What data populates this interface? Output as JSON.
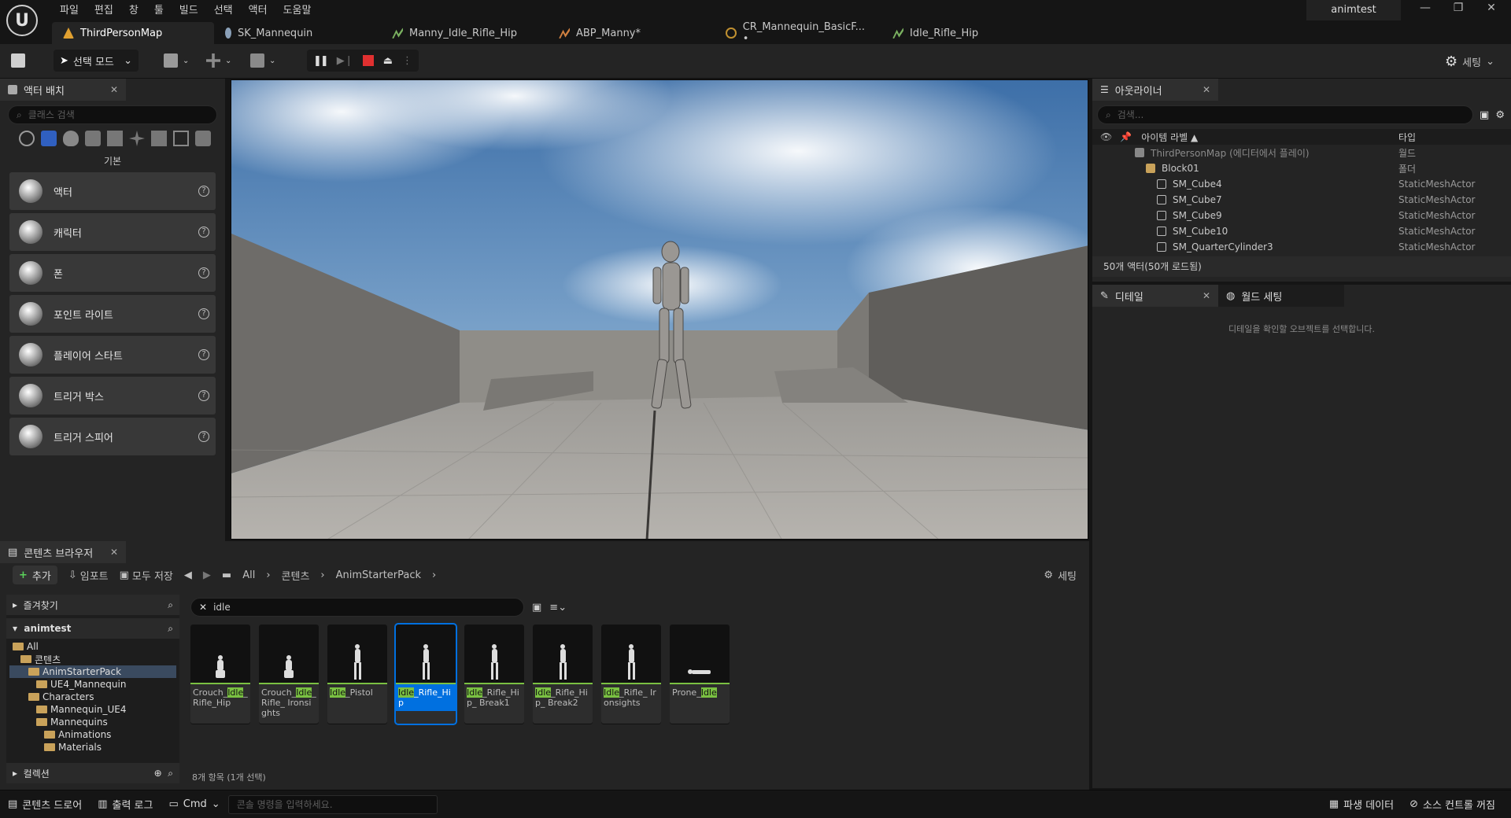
{
  "app": {
    "logo": "U",
    "project": "animtest"
  },
  "menu": [
    "파일",
    "편집",
    "창",
    "툴",
    "빌드",
    "선택",
    "액터",
    "도움말"
  ],
  "window_controls": [
    "—",
    "❐",
    "✕"
  ],
  "tabs": [
    {
      "label": "ThirdPersonMap",
      "icon": "map-icon",
      "color": "#e0a030",
      "active": true
    },
    {
      "label": "SK_Mannequin",
      "icon": "skeleton-icon",
      "color": "#9ab",
      "active": false
    },
    {
      "label": "Manny_Idle_Rifle_Hip",
      "icon": "anim-sequence-icon",
      "color": "#8c6",
      "active": false
    },
    {
      "label": "ABP_Manny*",
      "icon": "anim-blueprint-icon",
      "color": "#d84",
      "active": false
    },
    {
      "label": "CR_Mannequin_BasicF... •",
      "icon": "control-rig-icon",
      "color": "#c93",
      "active": false
    },
    {
      "label": "Idle_Rifle_Hip",
      "icon": "anim-sequence-icon",
      "color": "#8c6",
      "active": false
    }
  ],
  "toolbar": {
    "select_mode": "선택 모드",
    "settings": "세팅"
  },
  "place_actors": {
    "title": "액터 배치",
    "search_placeholder": "클래스 검색",
    "category": "기본",
    "items": [
      "액터",
      "캐릭터",
      "폰",
      "포인트 라이트",
      "플레이어 스타트",
      "트리거 박스",
      "트리거 스피어"
    ]
  },
  "outliner": {
    "title": "아웃라이너",
    "search_placeholder": "검색...",
    "col_label": "아이템 라벨 ▲",
    "col_type": "타입",
    "rows": [
      {
        "label": "ThirdPersonMap (에디터에서 플레이)",
        "type": "월드",
        "indent": 0
      },
      {
        "label": "Block01",
        "type": "폴더",
        "indent": 1
      },
      {
        "label": "SM_Cube4",
        "type": "StaticMeshActor",
        "indent": 2
      },
      {
        "label": "SM_Cube7",
        "type": "StaticMeshActor",
        "indent": 2
      },
      {
        "label": "SM_Cube9",
        "type": "StaticMeshActor",
        "indent": 2
      },
      {
        "label": "SM_Cube10",
        "type": "StaticMeshActor",
        "indent": 2
      },
      {
        "label": "SM_QuarterCylinder3",
        "type": "StaticMeshActor",
        "indent": 2
      }
    ],
    "footer": "50개 액터(50개 로드됨)"
  },
  "details": {
    "tab_details": "디테일",
    "tab_world": "월드 세팅",
    "empty_msg": "디테일을 확인할 오브젝트를 선택합니다."
  },
  "content_browser": {
    "title": "콘텐츠 브라우저",
    "add": "추가",
    "import": "임포트",
    "save_all": "모두 저장",
    "settings": "세팅",
    "breadcrumb": [
      "All",
      "콘텐츠",
      "AnimStarterPack"
    ],
    "favorites": "즐겨찾기",
    "project": "animtest",
    "collections": "컬렉션",
    "search_value": "idle",
    "tree": [
      {
        "label": "All",
        "depth": 0
      },
      {
        "label": "콘텐츠",
        "depth": 1
      },
      {
        "label": "AnimStarterPack",
        "depth": 2,
        "selected": true
      },
      {
        "label": "UE4_Mannequin",
        "depth": 3
      },
      {
        "label": "Characters",
        "depth": 2
      },
      {
        "label": "Mannequin_UE4",
        "depth": 3
      },
      {
        "label": "Mannequins",
        "depth": 3
      },
      {
        "label": "Animations",
        "depth": 4
      },
      {
        "label": "Materials",
        "depth": 4
      }
    ],
    "assets": [
      {
        "pre": "Crouch_",
        "hl": "Idle",
        "post": "_ Rifle_Hip",
        "pose": "crouch"
      },
      {
        "pre": "Crouch_",
        "hl": "Idle",
        "post": "_ Rifle_ Ironsights",
        "pose": "crouch"
      },
      {
        "pre": "",
        "hl": "Idle",
        "post": "_Pistol",
        "pose": "stand"
      },
      {
        "pre": "",
        "hl": "Idle",
        "post": "_Rifle_Hip",
        "pose": "stand",
        "selected": true
      },
      {
        "pre": "",
        "hl": "Idle",
        "post": "_Rifle_Hip_ Break1",
        "pose": "stand"
      },
      {
        "pre": "",
        "hl": "Idle",
        "post": "_Rifle_Hip_ Break2",
        "pose": "stand"
      },
      {
        "pre": "",
        "hl": "Idle",
        "post": "_Rifle_ Ironsights",
        "pose": "stand"
      },
      {
        "pre": "Prone_",
        "hl": "Idle",
        "post": "",
        "pose": "prone"
      }
    ],
    "count": "8개 항목 (1개 선택)"
  },
  "statusbar": {
    "drawer": "콘텐츠 드로어",
    "log": "출력 로그",
    "cmd": "Cmd",
    "cmd_placeholder": "콘솔 명령을 입력하세요.",
    "derived": "파생 데이터",
    "source": "소스 컨트롤 꺼짐"
  }
}
